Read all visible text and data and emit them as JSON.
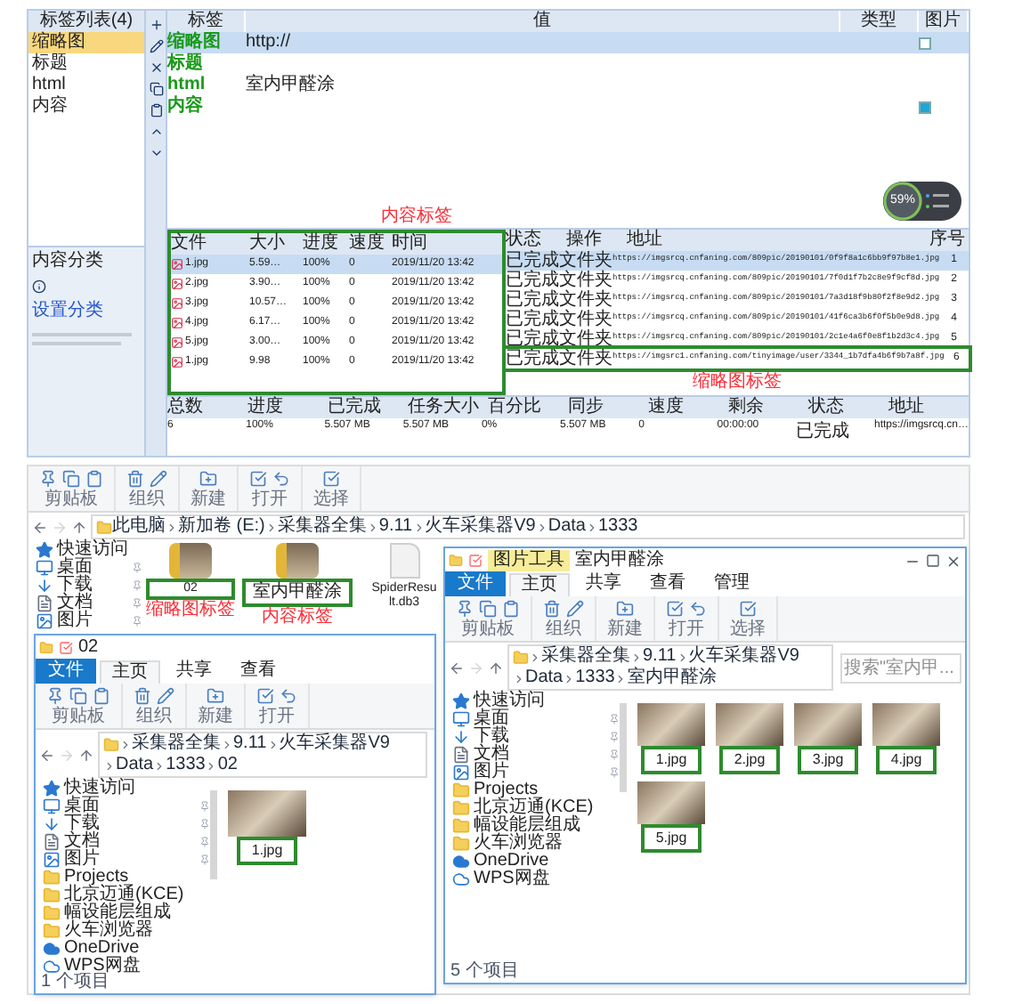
{
  "crawler": {
    "tag_list": {
      "title": "标签列表(4)",
      "items": [
        {
          "label": "缩略图",
          "selected": true
        },
        {
          "label": "标题",
          "selected": false
        },
        {
          "label": "html",
          "selected": false
        },
        {
          "label": "内容",
          "selected": false
        }
      ]
    },
    "tag_table": {
      "columns": [
        "标签",
        "值",
        "类型",
        "图片"
      ],
      "rows": [
        {
          "tag": "缩略图",
          "value": "http://",
          "selected": true,
          "checked": false
        },
        {
          "tag": "标题",
          "selected": false
        },
        {
          "tag": "html",
          "value": "室内甲醛涂",
          "selected": false
        },
        {
          "tag": "内容",
          "selected": false,
          "checked": true
        }
      ]
    },
    "category_panel": {
      "title": "内容分类",
      "link": "设置分类"
    },
    "content_note": "内容标签",
    "files": {
      "highlighted": true,
      "columns": [
        "文件",
        "大小",
        "进度",
        "速度",
        "时间"
      ],
      "rows": [
        {
          "name": "1.jpg",
          "size": "5.59…",
          "progress": "100%",
          "speed": "0",
          "time": "2019/11/20 13:42",
          "selected": true
        },
        {
          "name": "2.jpg",
          "size": "3.90…",
          "progress": "100%",
          "speed": "0",
          "time": "2019/11/20 13:42",
          "selected": false
        },
        {
          "name": "3.jpg",
          "size": "10.57…",
          "progress": "100%",
          "speed": "0",
          "time": "2019/11/20 13:42",
          "selected": false
        },
        {
          "name": "4.jpg",
          "size": "6.17…",
          "progress": "100%",
          "speed": "0",
          "time": "2019/11/20 13:42",
          "selected": false
        },
        {
          "name": "5.jpg",
          "size": "3.00…",
          "progress": "100%",
          "speed": "0",
          "time": "2019/11/20 13:42",
          "selected": false
        },
        {
          "name": "1.jpg",
          "size": "9.98",
          "progress": "100%",
          "speed": "0",
          "time": "2019/11/20 13:42",
          "selected": false
        }
      ]
    },
    "downloads": {
      "columns": [
        "状态",
        "操作",
        "地址",
        "序号"
      ],
      "rows": [
        {
          "status": "已完成",
          "action": "文件夹",
          "url": "https://imgsrcq.cnfaning.com/809pic/20190101/0f9f8a1c6bb9f97b8e1.jpg",
          "index": "1",
          "selected": true,
          "highlighted": false
        },
        {
          "status": "已完成",
          "action": "文件夹",
          "url": "https://imgsrcq.cnfaning.com/809pic/20190101/7f0d1f7b2c8e9f9cf8d.jpg",
          "index": "2",
          "selected": false,
          "highlighted": false
        },
        {
          "status": "已完成",
          "action": "文件夹",
          "url": "https://imgsrcq.cnfaning.com/809pic/20190101/7a3d18f9b80f2f8e9d2.jpg",
          "index": "3",
          "selected": false,
          "highlighted": false
        },
        {
          "status": "已完成",
          "action": "文件夹",
          "url": "https://imgsrcq.cnfaning.com/809pic/20190101/41f6ca3b6f0f5b0e9d8.jpg",
          "index": "4",
          "selected": false,
          "highlighted": false
        },
        {
          "status": "已完成",
          "action": "文件夹",
          "url": "https://imgsrcq.cnfaning.com/809pic/20190101/2c1e4a6f0e8f1b2d3c4.jpg",
          "index": "5",
          "selected": false,
          "highlighted": false
        },
        {
          "status": "已完成",
          "action": "文件夹",
          "url": "https://imgsrc1.cnfaning.com/tinyimage/user/3344_1b7dfa4b6f9b7a8f.jpg",
          "index": "6",
          "selected": false,
          "highlighted": true
        }
      ]
    },
    "thumb_note": "缩略图标签",
    "status_table": {
      "columns": [
        "总数",
        "进度",
        "已完成",
        "任务大小",
        "百分比",
        "同步",
        "速度",
        "剩余",
        "状态",
        "地址"
      ],
      "values": [
        "6",
        "100%",
        "5.507 MB",
        "5.507 MB",
        "0%",
        "5.507 MB",
        "0",
        "00:00:00",
        "已完成",
        "https://imgsrcq.cn…"
      ]
    },
    "speed_widget": {
      "percent": "59%"
    }
  },
  "explorer_main": {
    "ribbon_groups": [
      "剪贴板",
      "组织",
      "新建",
      "打开",
      "选择"
    ],
    "path": [
      "此电脑",
      "新加卷 (E:)",
      "采集器全集",
      "9.11",
      "火车采集器V9",
      "Data",
      "1333"
    ],
    "sidebar": [
      {
        "label": "快速访问",
        "kind": "star",
        "pinned": false
      },
      {
        "label": "桌面",
        "kind": "desktop",
        "pinned": true
      },
      {
        "label": "下载",
        "kind": "download",
        "pinned": true
      },
      {
        "label": "文档",
        "kind": "doc",
        "pinned": true
      },
      {
        "label": "图片",
        "kind": "picture",
        "pinned": true
      }
    ],
    "items": [
      {
        "name": "02",
        "kind": "folder",
        "highlighted": true,
        "note": "缩略图标签"
      },
      {
        "name": "室内甲醛涂",
        "kind": "folder",
        "highlighted": true,
        "note": "内容标签"
      },
      {
        "name": "SpiderResult.db3",
        "kind": "file",
        "highlighted": false
      }
    ]
  },
  "explorer_folder": {
    "title": "02",
    "tabs": [
      {
        "label": "文件",
        "kind": "file",
        "selected": false
      },
      {
        "label": "主页",
        "kind": "tab",
        "selected": true
      },
      {
        "label": "共享",
        "kind": "tab",
        "selected": false
      },
      {
        "label": "查看",
        "kind": "tab",
        "selected": false
      }
    ],
    "ribbon_groups": [
      "剪贴板",
      "组织",
      "新建",
      "打开"
    ],
    "path": [
      "采集器全集",
      "9.11",
      "火车采集器V9",
      "Data",
      "1333",
      "02"
    ],
    "sidebar": [
      {
        "label": "快速访问",
        "kind": "star",
        "pinned": false
      },
      {
        "label": "桌面",
        "kind": "desktop",
        "pinned": true
      },
      {
        "label": "下载",
        "kind": "download",
        "pinned": true
      },
      {
        "label": "文档",
        "kind": "doc",
        "pinned": true
      },
      {
        "label": "图片",
        "kind": "picture",
        "pinned": true
      },
      {
        "label": "Projects",
        "kind": "folder",
        "pinned": false
      },
      {
        "label": "北京迈通(KCE)",
        "kind": "folder",
        "pinned": false
      },
      {
        "label": "幅设能层组成",
        "kind": "folder",
        "pinned": false
      },
      {
        "label": "火车浏览器",
        "kind": "folder",
        "pinned": false
      },
      {
        "label": "OneDrive",
        "kind": "cloud",
        "pinned": false
      },
      {
        "label": "WPS网盘",
        "kind": "net",
        "pinned": false
      }
    ],
    "items": [
      {
        "name": "1.jpg",
        "kind": "image",
        "highlighted": true
      }
    ],
    "status": "1 个项目"
  },
  "explorer_images": {
    "tool_tab": "图片工具",
    "title": "室内甲醛涂",
    "tabs": [
      {
        "label": "文件",
        "kind": "file",
        "selected": false
      },
      {
        "label": "主页",
        "kind": "tab",
        "selected": true
      },
      {
        "label": "共享",
        "kind": "tab",
        "selected": false
      },
      {
        "label": "查看",
        "kind": "tab",
        "selected": false
      },
      {
        "label": "管理",
        "kind": "tab",
        "selected": false
      }
    ],
    "ribbon_groups": [
      "剪贴板",
      "组织",
      "新建",
      "打开",
      "选择"
    ],
    "path": [
      "采集器全集",
      "9.11",
      "火车采集器V9",
      "Data",
      "1333",
      "室内甲醛涂"
    ],
    "search_placeholder": "搜索\"室内甲...",
    "sidebar": [
      {
        "label": "快速访问",
        "kind": "star",
        "pinned": false
      },
      {
        "label": "桌面",
        "kind": "desktop",
        "pinned": true
      },
      {
        "label": "下载",
        "kind": "download",
        "pinned": true
      },
      {
        "label": "文档",
        "kind": "doc",
        "pinned": true
      },
      {
        "label": "图片",
        "kind": "picture",
        "pinned": true
      },
      {
        "label": "Projects",
        "kind": "folder",
        "pinned": false
      },
      {
        "label": "北京迈通(KCE)",
        "kind": "folder",
        "pinned": false
      },
      {
        "label": "幅设能层组成",
        "kind": "folder",
        "pinned": false
      },
      {
        "label": "火车浏览器",
        "kind": "folder",
        "pinned": false
      },
      {
        "label": "OneDrive",
        "kind": "cloud",
        "pinned": false
      },
      {
        "label": "WPS网盘",
        "kind": "net",
        "pinned": false
      }
    ],
    "items": [
      {
        "name": "1.jpg",
        "kind": "image",
        "highlighted": true
      },
      {
        "name": "2.jpg",
        "kind": "image",
        "highlighted": true
      },
      {
        "name": "3.jpg",
        "kind": "image",
        "highlighted": true
      },
      {
        "name": "4.jpg",
        "kind": "image",
        "highlighted": true
      },
      {
        "name": "5.jpg",
        "kind": "image",
        "highlighted": true
      }
    ],
    "status": "5 个项目"
  }
}
